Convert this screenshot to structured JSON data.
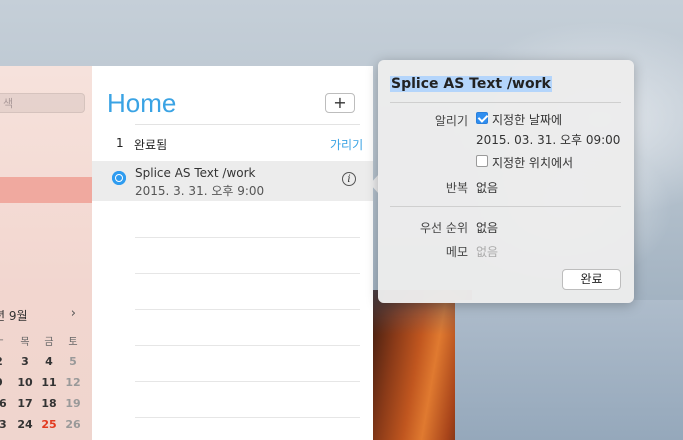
{
  "sidebar": {
    "search_placeholder": "색",
    "calendar": {
      "month_label": "년 9월",
      "next_icon": "chevron-right-icon",
      "weekdays": [
        "ㅜ",
        "목",
        "금",
        "토"
      ],
      "weeks": [
        [
          "2",
          "3",
          "4",
          "5"
        ],
        [
          "9",
          "10",
          "11",
          "12"
        ],
        [
          "16",
          "17",
          "18",
          "19"
        ],
        [
          "23",
          "24",
          "25",
          "26"
        ]
      ],
      "today": "25"
    }
  },
  "main": {
    "title": "Home",
    "add_label": "+",
    "completed_count": "1",
    "completed_label": "완료됨",
    "hide_label": "가리기",
    "task": {
      "title": "Splice AS Text /work",
      "date": "2015. 3. 31. 오후 9:00",
      "info_icon": "i"
    }
  },
  "popover": {
    "title": "Splice AS Text /work",
    "alert_label": "알리기",
    "on_date_label": "지정한 날짜에",
    "on_date_checked": true,
    "alert_datetime": "2015. 03. 31. 오후 09:00",
    "at_location_label": "지정한 위치에서",
    "at_location_checked": false,
    "repeat_label": "반복",
    "repeat_value": "없음",
    "priority_label": "우선 순위",
    "priority_value": "없음",
    "memo_label": "메모",
    "memo_placeholder": "없음",
    "done_label": "완료"
  },
  "colors": {
    "accent": "#3aa3e4",
    "today": "#e2391f",
    "sidebar_selection": "#f0a99f"
  }
}
